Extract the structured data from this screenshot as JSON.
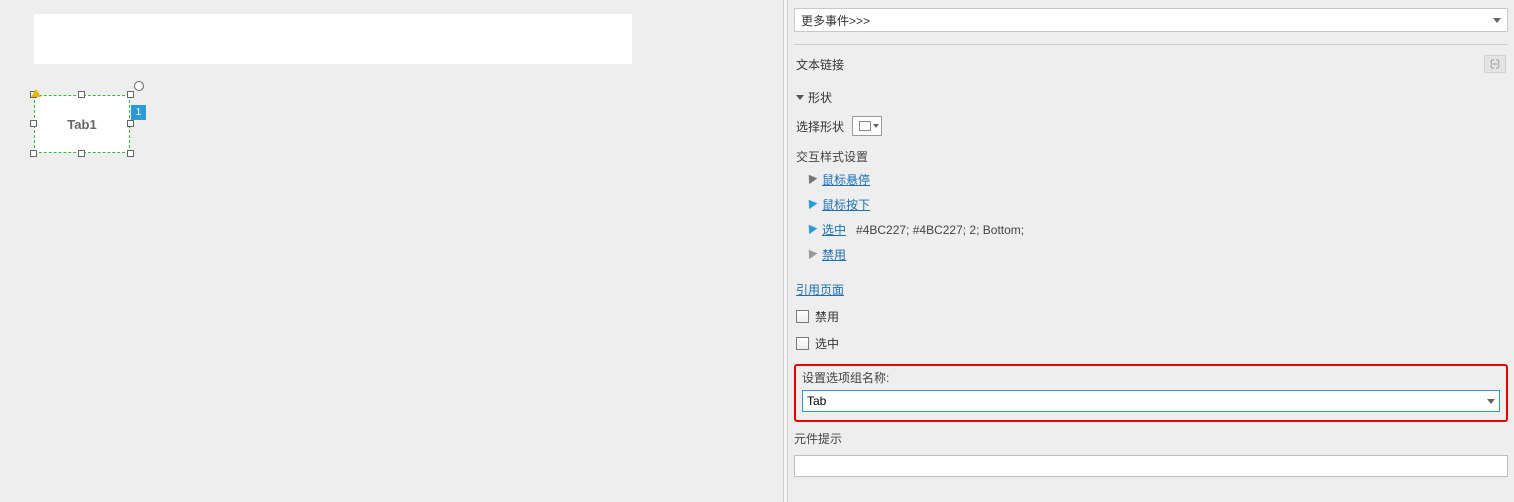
{
  "canvas": {
    "selected_element_label": "Tab1",
    "badge_number": "1"
  },
  "panel": {
    "more_events": "更多事件>>>",
    "text_link_label": "文本链接",
    "shape_section": "形状",
    "select_shape_label": "选择形状",
    "interaction_header": "交互样式设置",
    "style_hover": "鼠标悬停",
    "style_press": "鼠标按下",
    "style_selected": "选中",
    "style_selected_suffix": "#4BC227; #4BC227; 2; Bottom;",
    "style_disabled": "禁用",
    "ref_page": "引用页面",
    "checkbox_disabled": "禁用",
    "checkbox_selected": "选中",
    "group_name_label": "设置选项组名称:",
    "group_name_value": "Tab",
    "tooltip_label": "元件提示",
    "tooltip_value": ""
  }
}
